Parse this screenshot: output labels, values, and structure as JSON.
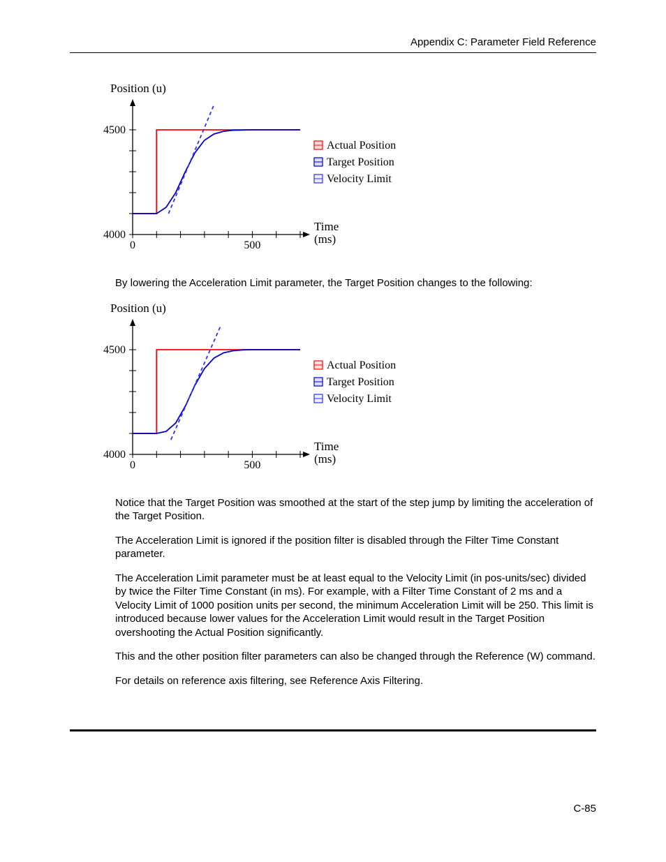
{
  "header": {
    "title": "Appendix C:  Parameter Field Reference"
  },
  "page_number": "C-85",
  "paragraphs": {
    "p1": "By lowering the Acceleration Limit parameter, the Target Position changes to the following:",
    "p2": "Notice that the Target Position was smoothed at the start of the step jump by limiting the acceleration of the Target Position.",
    "p3": "The Acceleration Limit is ignored if the position filter is disabled through the Filter Time Constant parameter.",
    "p4": "The Acceleration Limit parameter must be at least equal to the Velocity Limit (in pos-units/sec) divided by twice the Filter Time Constant (in ms). For example, with a Filter Time Constant of 2 ms and a Velocity Limit of 1000 position units per second, the minimum Acceleration Limit will be 250. This limit is introduced because lower values for the Acceleration Limit would result in the Target Position overshooting the Actual Position significantly.",
    "p5": "This and the other position filter parameters can also be changed through the Reference (W) command.",
    "p6": "For details on reference axis filtering, see Reference Axis Filtering."
  },
  "chart_data": [
    {
      "type": "line",
      "title": "",
      "xlabel": "Time (ms)",
      "ylabel": "Position (u)",
      "xlim": [
        0,
        700
      ],
      "ylim": [
        4000,
        4600
      ],
      "xticks": [
        0,
        100,
        200,
        300,
        400,
        500,
        600,
        700
      ],
      "yticks": [
        4000,
        4100,
        4200,
        4300,
        4400,
        4500
      ],
      "xtick_labels": [
        "0",
        "",
        "",
        "",
        "",
        "500",
        "",
        ""
      ],
      "ytick_labels": [
        "4000",
        "",
        "",
        "",
        "",
        "4500"
      ],
      "legend": [
        "Actual Position",
        "Target Position",
        "Velocity Limit"
      ],
      "series": [
        {
          "name": "Actual Position",
          "color": "#ff0000",
          "x": [
            0,
            100,
            100,
            700
          ],
          "y": [
            4100,
            4100,
            4500,
            4500
          ]
        },
        {
          "name": "Target Position",
          "color": "#0000cc",
          "x": [
            0,
            100,
            140,
            180,
            220,
            260,
            300,
            340,
            380,
            420,
            500,
            700
          ],
          "y": [
            4100,
            4100,
            4130,
            4200,
            4300,
            4390,
            4450,
            4480,
            4493,
            4498,
            4500,
            4500
          ]
        },
        {
          "name": "Velocity Limit",
          "color": "#3030ff",
          "dashed": true,
          "x": [
            150,
            340
          ],
          "y": [
            4100,
            4620
          ]
        }
      ]
    },
    {
      "type": "line",
      "title": "",
      "xlabel": "Time (ms)",
      "ylabel": "Position (u)",
      "xlim": [
        0,
        700
      ],
      "ylim": [
        4000,
        4600
      ],
      "xticks": [
        0,
        100,
        200,
        300,
        400,
        500,
        600,
        700
      ],
      "yticks": [
        4000,
        4100,
        4200,
        4300,
        4400,
        4500
      ],
      "xtick_labels": [
        "0",
        "",
        "",
        "",
        "",
        "500",
        "",
        ""
      ],
      "ytick_labels": [
        "4000",
        "",
        "",
        "",
        "",
        "4500"
      ],
      "legend": [
        "Actual Position",
        "Target Position",
        "Velocity Limit"
      ],
      "series": [
        {
          "name": "Actual Position",
          "color": "#ff0000",
          "x": [
            0,
            100,
            100,
            700
          ],
          "y": [
            4100,
            4100,
            4500,
            4500
          ]
        },
        {
          "name": "Target Position",
          "color": "#0000cc",
          "x": [
            0,
            100,
            140,
            180,
            220,
            260,
            300,
            340,
            380,
            420,
            460,
            500,
            700
          ],
          "y": [
            4100,
            4100,
            4110,
            4150,
            4230,
            4330,
            4410,
            4460,
            4485,
            4495,
            4499,
            4500,
            4500
          ]
        },
        {
          "name": "Velocity Limit",
          "color": "#3030ff",
          "dashed": true,
          "x": [
            160,
            370
          ],
          "y": [
            4070,
            4620
          ]
        }
      ]
    }
  ]
}
